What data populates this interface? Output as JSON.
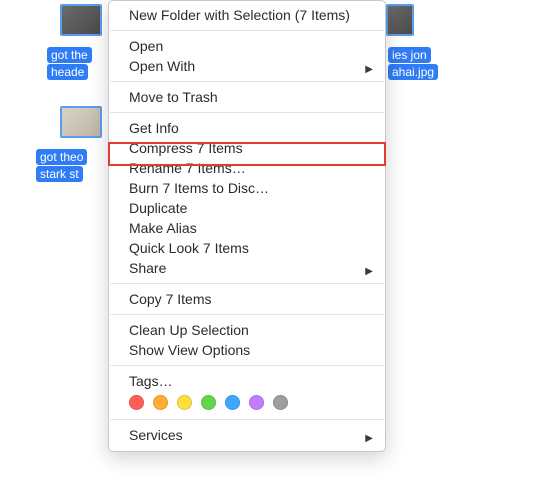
{
  "background": {
    "file1": {
      "label_line1": "got the",
      "label_line2": "heade"
    },
    "file2": {
      "label_line1": "ies jon",
      "label_line2": "ahai.jpg"
    },
    "file3": {
      "label_line1": "got theo",
      "label_line2": "stark st"
    }
  },
  "menu": {
    "new_folder": "New Folder with Selection (7 Items)",
    "open": "Open",
    "open_with": "Open With",
    "move_to_trash": "Move to Trash",
    "get_info": "Get Info",
    "compress": "Compress 7 Items",
    "rename": "Rename 7 Items…",
    "burn": "Burn 7 Items to Disc…",
    "duplicate": "Duplicate",
    "make_alias": "Make Alias",
    "quick_look": "Quick Look 7 Items",
    "share": "Share",
    "copy": "Copy 7 Items",
    "clean_up": "Clean Up Selection",
    "show_view_options": "Show View Options",
    "tags": "Tags…",
    "services": "Services"
  },
  "tag_colors": {
    "red": "#ff5f57",
    "orange": "#ffae33",
    "yellow": "#ffdf3d",
    "green": "#62d64b",
    "blue": "#3ea7ff",
    "purple": "#c17dff",
    "gray": "#9e9e9e"
  }
}
